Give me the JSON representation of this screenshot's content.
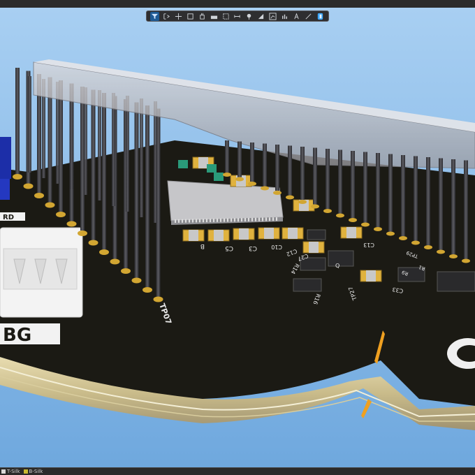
{
  "toolbar": {
    "tools": [
      {
        "name": "filter-icon",
        "active": true
      },
      {
        "name": "select-objects-icon"
      },
      {
        "name": "crosshair-icon"
      },
      {
        "name": "rectangle-select-icon"
      },
      {
        "name": "place-component-icon"
      },
      {
        "name": "board-layer-icon"
      },
      {
        "name": "region-select-icon"
      },
      {
        "name": "measure-icon"
      },
      {
        "name": "pin-marker-icon"
      },
      {
        "name": "fill-shape-icon"
      },
      {
        "name": "chart-icon"
      },
      {
        "name": "bar-graph-icon"
      },
      {
        "name": "text-icon"
      },
      {
        "name": "line-icon"
      },
      {
        "name": "view-config-icon"
      }
    ]
  },
  "statusbar": {
    "layers": [
      {
        "label": "T-Silk",
        "color": "#d8d8d8"
      },
      {
        "label": "B-Silk",
        "color": "#c8b830"
      }
    ]
  },
  "board": {
    "colors": {
      "mask": "#1b1a14",
      "copper_pad": "#d2a632",
      "smd_cap": "#e0b23e",
      "header_pin": "#3a3a3e",
      "housing": "#c8c8cc",
      "connector": "#f2f2f2",
      "sky": "#8fc0ec"
    },
    "silk_labels": {
      "j_label": "BG",
      "rd_label": "RD",
      "tp": "TP07",
      "c_b": "B",
      "c_c5": "C5",
      "c_c3": "C3",
      "c_c10": "C10",
      "c_c12": "C12",
      "c_c27": "C27",
      "c_c13": "C13",
      "c_c33": "C33",
      "r_r14": "R14",
      "r_r16": "R16",
      "u_q": "Q",
      "tp_label": "TP27",
      "r_r9": "R9",
      "r_r1": "R1",
      "tp_label2": "TP29"
    }
  }
}
